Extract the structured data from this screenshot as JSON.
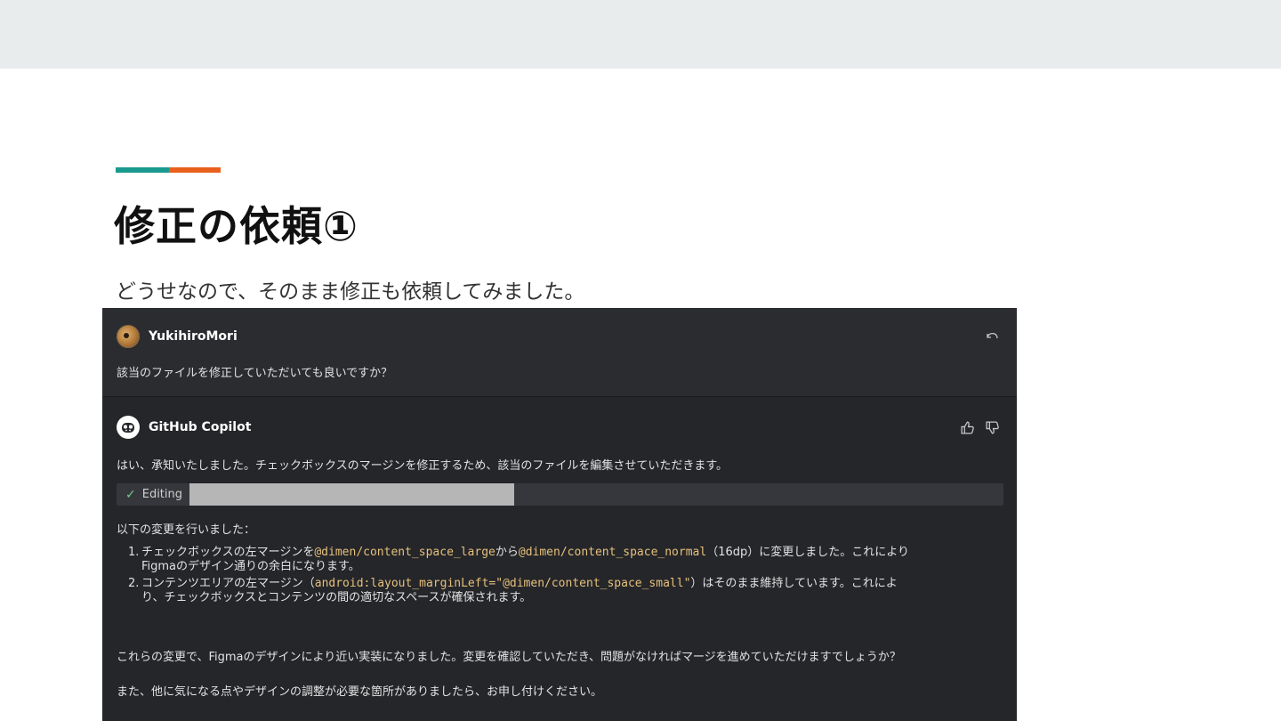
{
  "colors": {
    "accent_teal": "#1a9a8f",
    "accent_orange": "#e8601c",
    "chat_bg": "#25262a",
    "code_color": "#e5c07b",
    "check_color": "#73c991"
  },
  "slide": {
    "title": "修正の依頼①",
    "subtitle": "どうせなので、そのまま修正も依頼してみました。"
  },
  "chat": {
    "user": {
      "name": "YukihiroMori",
      "avatar_icon": "avatar",
      "message": "該当のファイルを修正していただいても良いですか？",
      "undo_icon": "undo-icon"
    },
    "copilot": {
      "name": "GitHub Copilot",
      "icon": "copilot-icon",
      "thumbs_up_icon": "thumbs-up-icon",
      "thumbs_down_icon": "thumbs-down-icon",
      "intro": "はい、承知いたしました。チェックボックスのマージンを修正するため、該当のファイルを編集させていただきます。",
      "editing_label": "Editing",
      "changes_heading": "以下の変更を行いました：",
      "changes": [
        {
          "num": "1.",
          "line1_pre": "チェックボックスの左マージンを",
          "line1_code1": "@dimen/content_space_large",
          "line1_mid": "から",
          "line1_code2": "@dimen/content_space_normal",
          "line1_post": "（16dp）に変更しました。これにより",
          "line2": "Figmaのデザイン通りの余白になります。"
        },
        {
          "num": "2.",
          "line1_pre": "コンテンツエリアの左マージン（",
          "line1_code1": "android:layout_marginLeft=\"@dimen/content_space_small\"",
          "line1_post": "）はそのまま維持しています。これによ",
          "line2": "り、チェックボックスとコンテンツの間の適切なスペースが確保されます。"
        }
      ],
      "summary": "これらの変更で、Figmaのデザインにより近い実装になりました。変更を確認していただき、問題がなければマージを進めていただけますでしょうか？",
      "closing": "また、他に気になる点やデザインの調整が必要な箇所がありましたら、お申し付けください。"
    }
  }
}
